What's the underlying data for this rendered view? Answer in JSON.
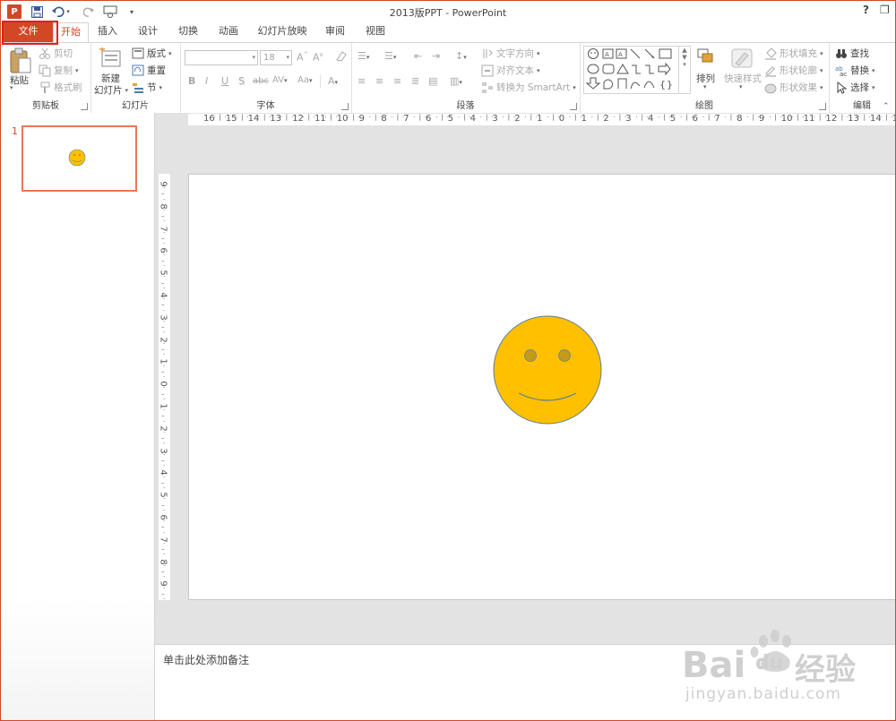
{
  "window": {
    "title": "2013版PPT - PowerPoint",
    "help_label": "?",
    "restore_label": "❐"
  },
  "qat": {
    "app_icon": "powerpoint-logo-icon",
    "app_letter": "P",
    "save": "save-icon",
    "undo": "undo-icon",
    "redo": "redo-icon",
    "slideshow": "start-from-beginning-icon",
    "customize": "customize-qat-icon"
  },
  "tabs": [
    {
      "label": "文件"
    },
    {
      "label": "开始"
    },
    {
      "label": "插入"
    },
    {
      "label": "设计"
    },
    {
      "label": "切换"
    },
    {
      "label": "动画"
    },
    {
      "label": "幻灯片放映"
    },
    {
      "label": "审阅"
    },
    {
      "label": "视图"
    }
  ],
  "ribbon": {
    "clipboard": {
      "label": "剪贴板",
      "paste": "粘贴",
      "cut": "剪切",
      "copy": "复制",
      "format_painter": "格式刷"
    },
    "slides": {
      "label": "幻灯片",
      "new_slide_line1": "新建",
      "new_slide_line2": "幻灯片",
      "layout": "版式",
      "reset": "重置",
      "section": "节"
    },
    "font": {
      "label": "字体",
      "font_name": "",
      "font_size": "18",
      "bold": "B",
      "italic": "I",
      "underline": "U",
      "shadow": "S",
      "strike": "abc",
      "spacing": "AV",
      "case": "Aa",
      "color": "A"
    },
    "paragraph": {
      "label": "段落",
      "text_direction": "文字方向",
      "align_text": "对齐文本",
      "convert_smartart": "转换为 SmartArt"
    },
    "drawing": {
      "label": "绘图",
      "arrange": "排列",
      "quick_styles": "快速样式",
      "shape_fill": "形状填充",
      "shape_outline": "形状轮廓",
      "shape_effects": "形状效果"
    },
    "editing": {
      "label": "编辑",
      "find": "查找",
      "replace": "替换",
      "select": "选择"
    }
  },
  "ruler": {
    "horizontal": [
      "16",
      "15",
      "14",
      "13",
      "12",
      "11",
      "10",
      "9",
      "8",
      "7",
      "6",
      "5",
      "4",
      "3",
      "2",
      "1",
      "0",
      "1",
      "2",
      "3",
      "4",
      "5",
      "6",
      "7",
      "8",
      "9",
      "10",
      "11",
      "12",
      "13",
      "14",
      "15"
    ],
    "vertical": [
      "9",
      "8",
      "7",
      "6",
      "5",
      "4",
      "3",
      "2",
      "1",
      "0",
      "1",
      "2",
      "3",
      "4",
      "5",
      "6",
      "7",
      "8",
      "9"
    ]
  },
  "thumbnails": [
    {
      "number": "1"
    }
  ],
  "notes": {
    "placeholder": "单击此处添加备注"
  },
  "slide": {
    "shape": "smiley-face",
    "fill": "#ffc000",
    "outline": "#5b7f95",
    "eye_fill": "#c39a1b"
  },
  "watermark": {
    "brand_latin": "Bai",
    "brand_paw": "du",
    "brand_cn": "经验",
    "url": "jingyan.baidu.com"
  },
  "colors": {
    "accent": "#d24726",
    "highlight_box": "#e0201d"
  }
}
